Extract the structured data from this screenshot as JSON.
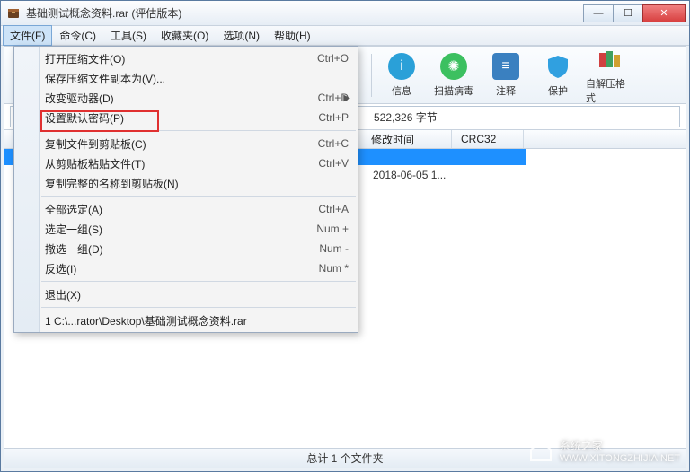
{
  "window": {
    "title": "基础测试概念资料.rar (评估版本)"
  },
  "menubar": {
    "items": [
      {
        "label": "文件(F)",
        "active": true
      },
      {
        "label": "命令(C)"
      },
      {
        "label": "工具(S)"
      },
      {
        "label": "收藏夹(O)"
      },
      {
        "label": "选项(N)"
      },
      {
        "label": "帮助(H)"
      }
    ]
  },
  "toolbar": {
    "items": [
      {
        "label": "信息",
        "name": "info-button",
        "color": "#2aa0d8"
      },
      {
        "label": "扫描病毒",
        "name": "scan-button",
        "color": "#3cc060"
      },
      {
        "label": "注释",
        "name": "comment-button",
        "color": "#3a80c0"
      },
      {
        "label": "保护",
        "name": "protect-button",
        "color": "#30a0e0"
      },
      {
        "label": "自解压格式",
        "name": "sfx-button",
        "color": "#d08030"
      }
    ]
  },
  "pathbar": {
    "text": "522,326 字节"
  },
  "columns": {
    "c1": "修改时间",
    "c2": "CRC32"
  },
  "filerow": {
    "date": "2018-06-05 1..."
  },
  "statusbar": {
    "text": "总计 1 个文件夹"
  },
  "dropdown": {
    "items": [
      {
        "label": "打开压缩文件(O)",
        "shortcut": "Ctrl+O"
      },
      {
        "label": "保存压缩文件副本为(V)...",
        "shortcut": ""
      },
      {
        "label": "改变驱动器(D)",
        "shortcut": "Ctrl+D",
        "arrow": true
      },
      {
        "label": "设置默认密码(P)",
        "shortcut": "Ctrl+P"
      },
      {
        "sep": true
      },
      {
        "label": "复制文件到剪贴板(C)",
        "shortcut": "Ctrl+C"
      },
      {
        "label": "从剪贴板粘贴文件(T)",
        "shortcut": "Ctrl+V"
      },
      {
        "label": "复制完整的名称到剪贴板(N)",
        "shortcut": ""
      },
      {
        "sep": true
      },
      {
        "label": "全部选定(A)",
        "shortcut": "Ctrl+A"
      },
      {
        "label": "选定一组(S)",
        "shortcut": "Num +"
      },
      {
        "label": "撤选一组(D)",
        "shortcut": "Num -"
      },
      {
        "label": "反选(I)",
        "shortcut": "Num *"
      },
      {
        "sep": true
      },
      {
        "label": "退出(X)",
        "shortcut": ""
      },
      {
        "sep": true
      },
      {
        "label": "1   C:\\...rator\\Desktop\\基础测试概念资料.rar",
        "shortcut": ""
      }
    ]
  },
  "watermark": {
    "brand": "系统之家",
    "url": "WWW.XITONGZHIJIA.NET"
  }
}
